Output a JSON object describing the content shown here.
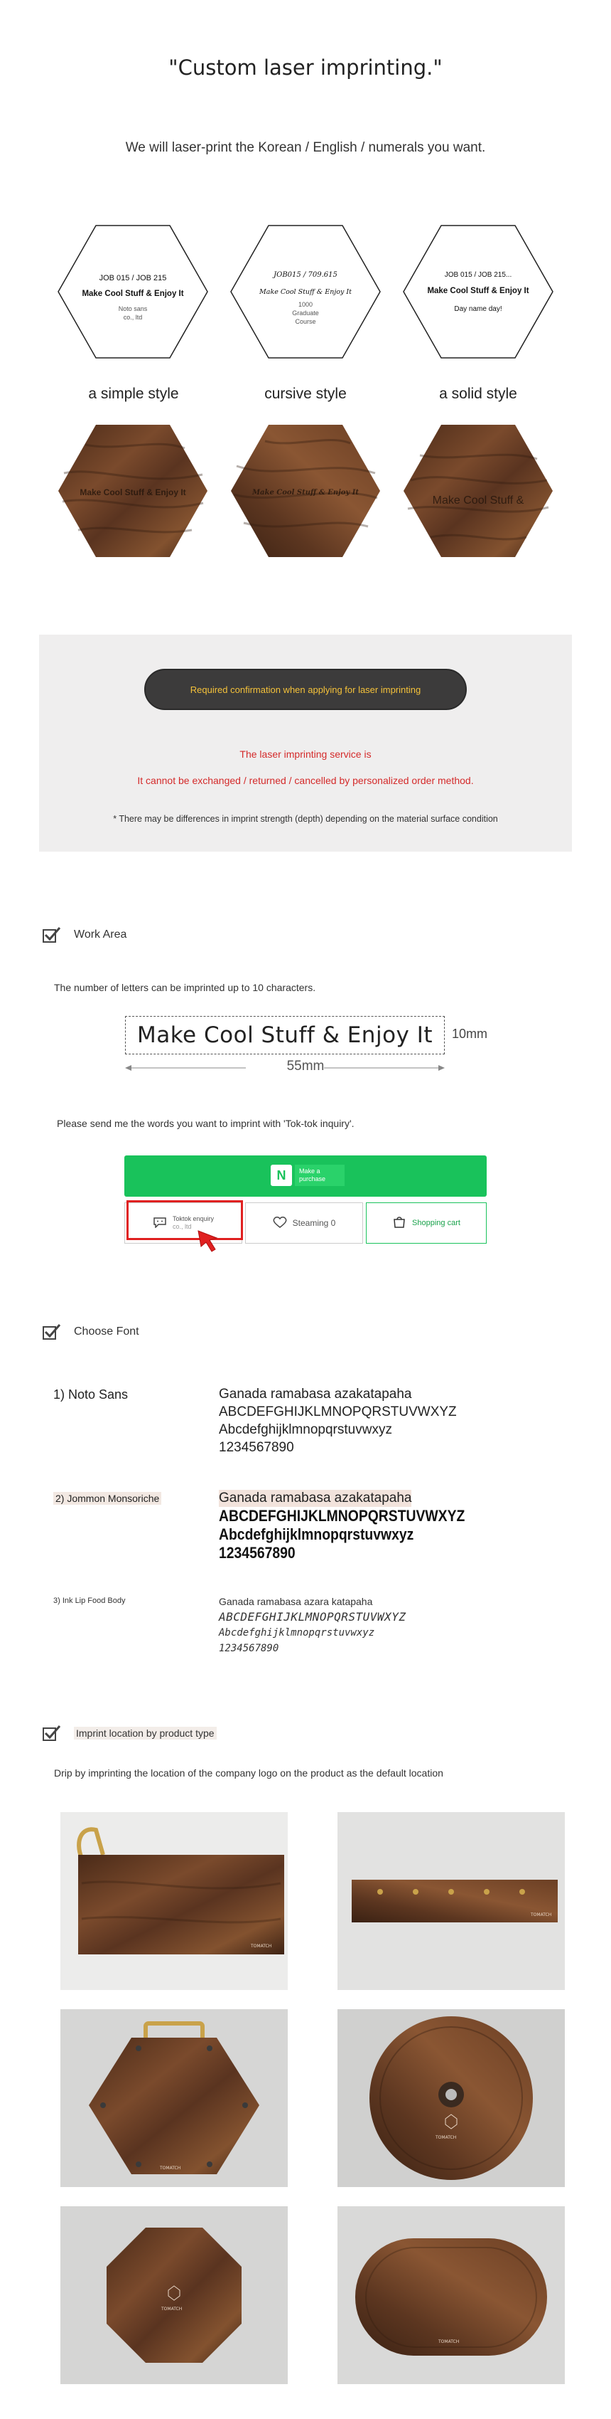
{
  "header": {
    "title": "\"Custom laser imprinting.\"",
    "subtitle": "We will laser-print the Korean / English / numerals you want."
  },
  "styles": [
    {
      "label": "a simple style",
      "hex_line1": "JOB 015 / JOB 215",
      "hex_line2": "Make Cool Stuff & Enjoy It",
      "hex_line3": "Noto sans",
      "hex_line4": "co., ltd",
      "wood_text": "Make Cool Stuff & Enjoy It"
    },
    {
      "label": "cursive style",
      "hex_line1": "JOB015 / 709.615",
      "hex_line2": "Make Cool Stuff & Enjoy It",
      "hex_line3": "1000",
      "hex_line4": "Graduate",
      "hex_line5": "Course",
      "wood_text": "Make Cool Stuff & Enjoy It"
    },
    {
      "label": "a solid style",
      "hex_line1": "JOB 015 / JOB 215...",
      "hex_line2": "Make Cool Stuff & Enjoy It",
      "hex_line3": "Day name day!",
      "wood_text": "Make Cool Stuff &"
    }
  ],
  "notice": {
    "pill": "Required confirmation when applying for laser imprinting",
    "red1": "The laser imprinting service is",
    "red2": "It cannot be exchanged / returned / cancelled by personalized order method.",
    "foot": "* There may be differences in imprint strength (depth) depending on the material surface condition"
  },
  "work_area": {
    "heading": "Work Area",
    "limit_text": "The number of letters can be imprinted up to 10 characters.",
    "sample": "Make Cool Stuff & Enjoy It",
    "height_label": "10mm",
    "width_label": "55mm",
    "send_text": "Please send me the words you want to imprint with 'Tok-tok inquiry'.",
    "naver_badge": "N",
    "buy_label": "Make a purchase",
    "talk_label": "Toktok enquiry",
    "talk_sub": "co., ltd",
    "wish_label": "Steaming 0",
    "cart_label": "Shopping cart"
  },
  "fonts": {
    "heading": "Choose Font",
    "items": [
      {
        "name": "1) Noto Sans",
        "line1": "Ganada ramabasa azakatapaha",
        "line2": "ABCDEFGHIJKLMNOPQRSTUVWXYZ",
        "line3": "Abcdefghijklmnopqrstuvwxyz",
        "line4": "1234567890"
      },
      {
        "name": "2) Jommon Monsoriche",
        "line1": "Ganada ramabasa azakatapaha",
        "line2": "ABCDEFGHIJKLMNOPQRSTUVWXYZ",
        "line3": "Abcdefghijklmnopqrstuvwxyz",
        "line4": "1234567890"
      },
      {
        "name": "3) Ink Lip Food Body",
        "line1": "Ganada ramabasa azara katapaha",
        "line2": "ABCDEFGHIJKLMNOPQRSTUVWXYZ",
        "line3": "Abcdefghijklmnopqrstuvwxyz",
        "line4": "1234567890"
      }
    ]
  },
  "location": {
    "heading": "Imprint location by product type",
    "desc": "Drip by imprinting the location of the company logo on the product as the default location"
  },
  "colors": {
    "green": "#19c25b",
    "red": "#d42a2a",
    "pill_text": "#f4c13a",
    "walnut": "#6b3f26"
  }
}
